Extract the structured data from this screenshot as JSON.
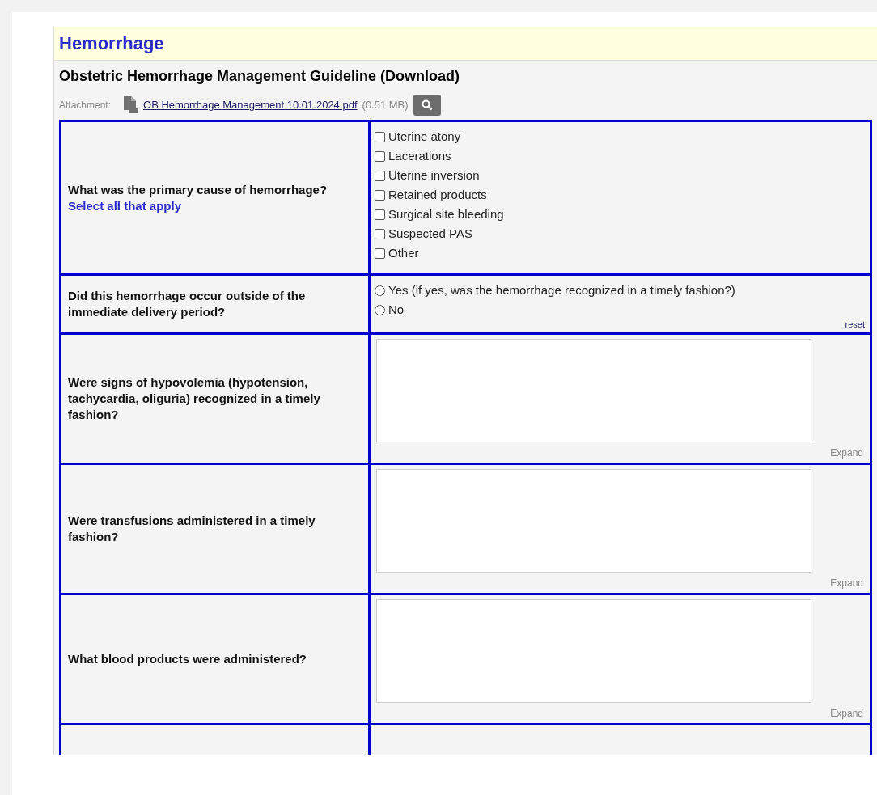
{
  "section_title": "Hemorrhage",
  "guideline_title": "Obstetric Hemorrhage Management Guideline (Download)",
  "attachment": {
    "label": "Attachment:",
    "file_name": "OB Hemorrhage Management 10.01.2024.pdf",
    "size": "(0.51 MB)"
  },
  "questions": [
    {
      "kind": "checkboxes",
      "question": "What was the primary cause of hemorrhage?",
      "hint": "Select all that apply",
      "options": [
        {
          "label": "Uterine atony",
          "checked": false
        },
        {
          "label": "Lacerations",
          "checked": false
        },
        {
          "label": "Uterine inversion",
          "checked": false
        },
        {
          "label": "Retained products",
          "checked": false
        },
        {
          "label": "Surgical site bleeding",
          "checked": false
        },
        {
          "label": "Suspected PAS",
          "checked": false
        },
        {
          "label": "Other",
          "checked": false
        }
      ]
    },
    {
      "kind": "radios",
      "question": "Did this hemorrhage occur outside of the immediate delivery period?",
      "options": [
        {
          "label": "Yes (if yes, was the hemorrhage recognized in a timely fashion?)",
          "selected": false
        },
        {
          "label": "No",
          "selected": false
        }
      ],
      "reset": "reset"
    },
    {
      "kind": "textarea",
      "question": "Were signs of hypovolemia (hypotension, tachycardia, oliguria) recognized in a timely fashion?",
      "expand": "Expand"
    },
    {
      "kind": "textarea",
      "question": "Were transfusions administered in a timely fashion?",
      "expand": "Expand"
    },
    {
      "kind": "textarea",
      "question": "What  blood products were administered?",
      "expand": "Expand"
    }
  ]
}
